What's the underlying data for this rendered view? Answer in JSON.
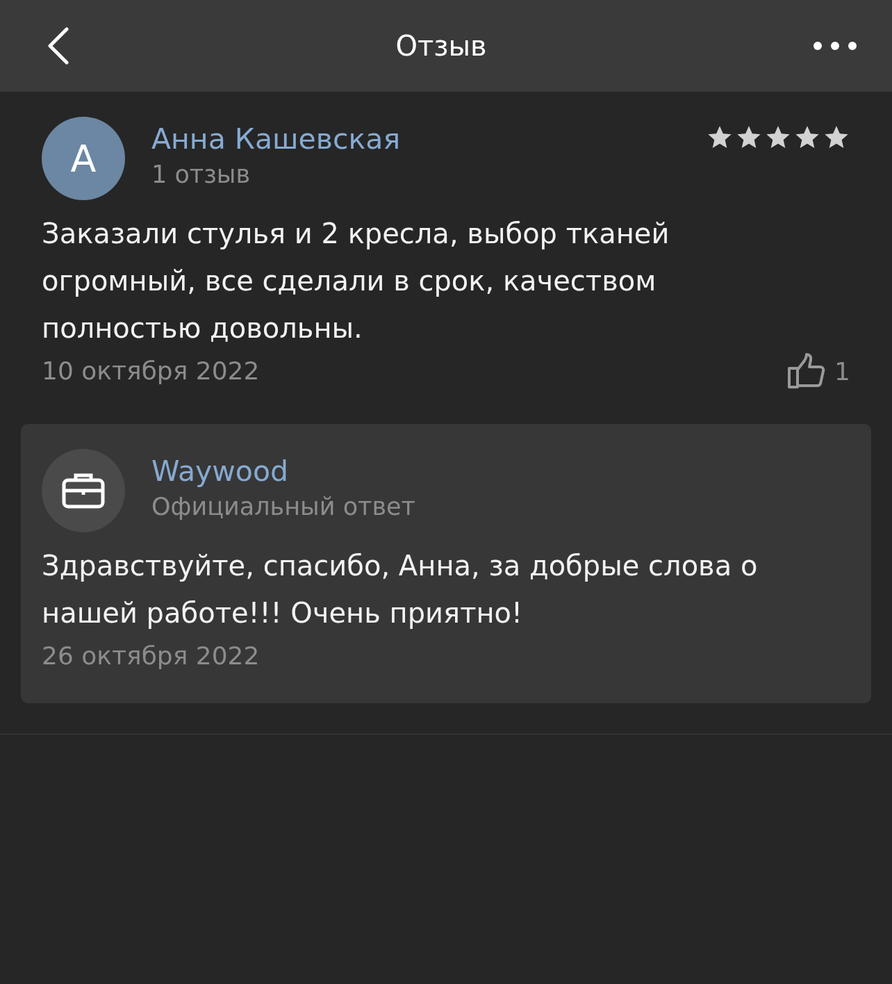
{
  "header": {
    "title": "Отзыв"
  },
  "review": {
    "avatar_letter": "А",
    "author": "Анна Кашевская",
    "author_reviews": "1 отзыв",
    "stars": 5,
    "text": "Заказали стулья и 2 кресла, выбор тканей огромный, все сделали в срок, качеством полностью довольны.",
    "date": "10 октября 2022",
    "likes": "1"
  },
  "reply": {
    "author": "Waywood",
    "subtitle": "Официальный ответ",
    "text": "Здравствуйте, спасибо, Анна, за добрые слова о нашей работе!!! Очень приятно!",
    "date": "26 октября 2022"
  }
}
